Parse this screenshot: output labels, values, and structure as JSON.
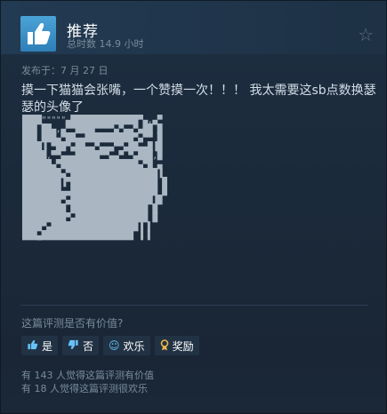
{
  "review": {
    "verdict": "推荐",
    "hours": "总时数 14.9 小时",
    "posted": "发布于：7 月 27 日",
    "text": "摸一下猫猫会张嘴，一个赞摸一次！！！ 我太需要这sb点数换瑟瑟的头像了",
    "ascii_art": [
      "████\"\"\"\"\"▄██████████████▀▄,▄▀",
      "███ ██▄,▄▀▀████▀▀▀▀▄▀▄▄▀▄██ █",
      "███ ███▄▀██▄▄██████████▀▄▀▀ █",
      "████▐ ▀██▀▄██▄▄▀▄▄▄▀▀▄██▄▄█▐█",
      "█████,▀▀▄▄▄█████▀▀▄▄▀ ▀▄███,█",
      "██████▄▀████████████████▄▀█ ▄",
      "████████▄▀██████████████████▐",
      "████████▐▀██████████████████ █",
      "████████▄▄██████████████████ █",
      "████████▀▄█████████████████▐█",
      "█████████ ████████████████ █",
      "█████████▀▄███████████████ █",
      "████▀▄██████████████████▐ ▌",
      "███▄███████████████████ ▐ ▌"
    ]
  },
  "feedback": {
    "question": "这篇评测是否有价值?",
    "yes": "是",
    "no": "否",
    "funny": "欢乐",
    "award": "奖励"
  },
  "stats": {
    "helpful": "有 143 人觉得这篇评测有价值",
    "funny": "有 18 人觉得这篇评测很欢乐"
  },
  "colors": {
    "background": "#1b2838",
    "accent": "#67c1f5",
    "award": "#e9b64a"
  },
  "icons": {
    "verdict": "thumbs-up-icon",
    "favorite": "star-icon",
    "yes": "thumbs-up-icon",
    "no": "thumbs-down-icon",
    "funny": "smiley-icon",
    "award": "award-icon"
  }
}
